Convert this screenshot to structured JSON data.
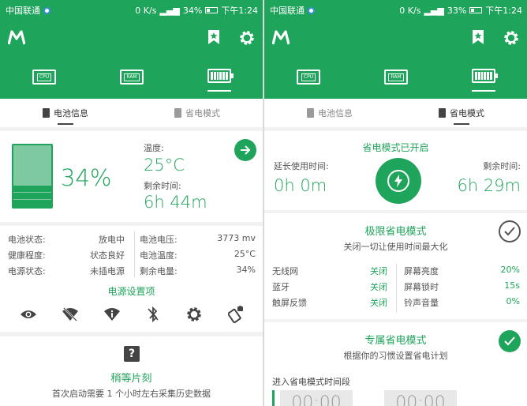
{
  "status_bar": {
    "left": {
      "carrier": "中国联通"
    },
    "right": {
      "speed": "0 K/s",
      "battery": "34%",
      "time": "下午1:24"
    },
    "right_r": {
      "speed": "0 K/s",
      "battery": "33%",
      "time": "下午1:24"
    }
  },
  "tabs": {
    "battery_info": "电池信息",
    "power_mode": "省电模式"
  },
  "left": {
    "battery_percent": "34%",
    "battery_level": 0.34,
    "temp_label": "温度:",
    "temp_value": "25°C",
    "remain_label": "剩余时间:",
    "remain_value": "6h 44m",
    "info_rows": [
      {
        "k1": "电池状态:",
        "v1": "放电中",
        "k2": "电池电压:",
        "v2": "3773 mv"
      },
      {
        "k1": "健康程度:",
        "v1": "状态良好",
        "k2": "电池温度:",
        "v2": "25°C"
      },
      {
        "k1": "电源状态:",
        "v1": "未插电源",
        "k2": "剩余电量:",
        "v2": "34%"
      }
    ],
    "power_settings_title": "电源设置项",
    "wait_title": "稍等片刻",
    "wait_desc": "首次启动需要 1 个小时左右采集历史数据"
  },
  "right": {
    "mode_on_title": "省电模式已开启",
    "extend_label": "延长使用时间:",
    "extend_value": "0h 0m",
    "remain_label": "剩余时间:",
    "remain_value": "6h 29m",
    "extreme_title": "极限省电模式",
    "extreme_desc": "关闭一切让使用时间最大化",
    "settings_rows": [
      {
        "k1": "无线网",
        "v1": "关闭",
        "k2": "屏幕亮度",
        "v2": "20%"
      },
      {
        "k1": "蓝牙",
        "v1": "关闭",
        "k2": "屏幕锁时",
        "v2": "15s"
      },
      {
        "k1": "触屏反馈",
        "v1": "关闭",
        "k2": "铃声音量",
        "v2": "0%"
      }
    ],
    "custom_title": "专属省电模式",
    "custom_desc": "根据你的习惯设置省电计划",
    "period_label": "进入省电模式时间段",
    "time_start": "00:00",
    "time_end": "00:00"
  },
  "chips": {
    "cpu": "CPU",
    "ram": "RAM"
  },
  "colors": {
    "accent": "#1fa45b",
    "background": "#f2f2f2"
  }
}
